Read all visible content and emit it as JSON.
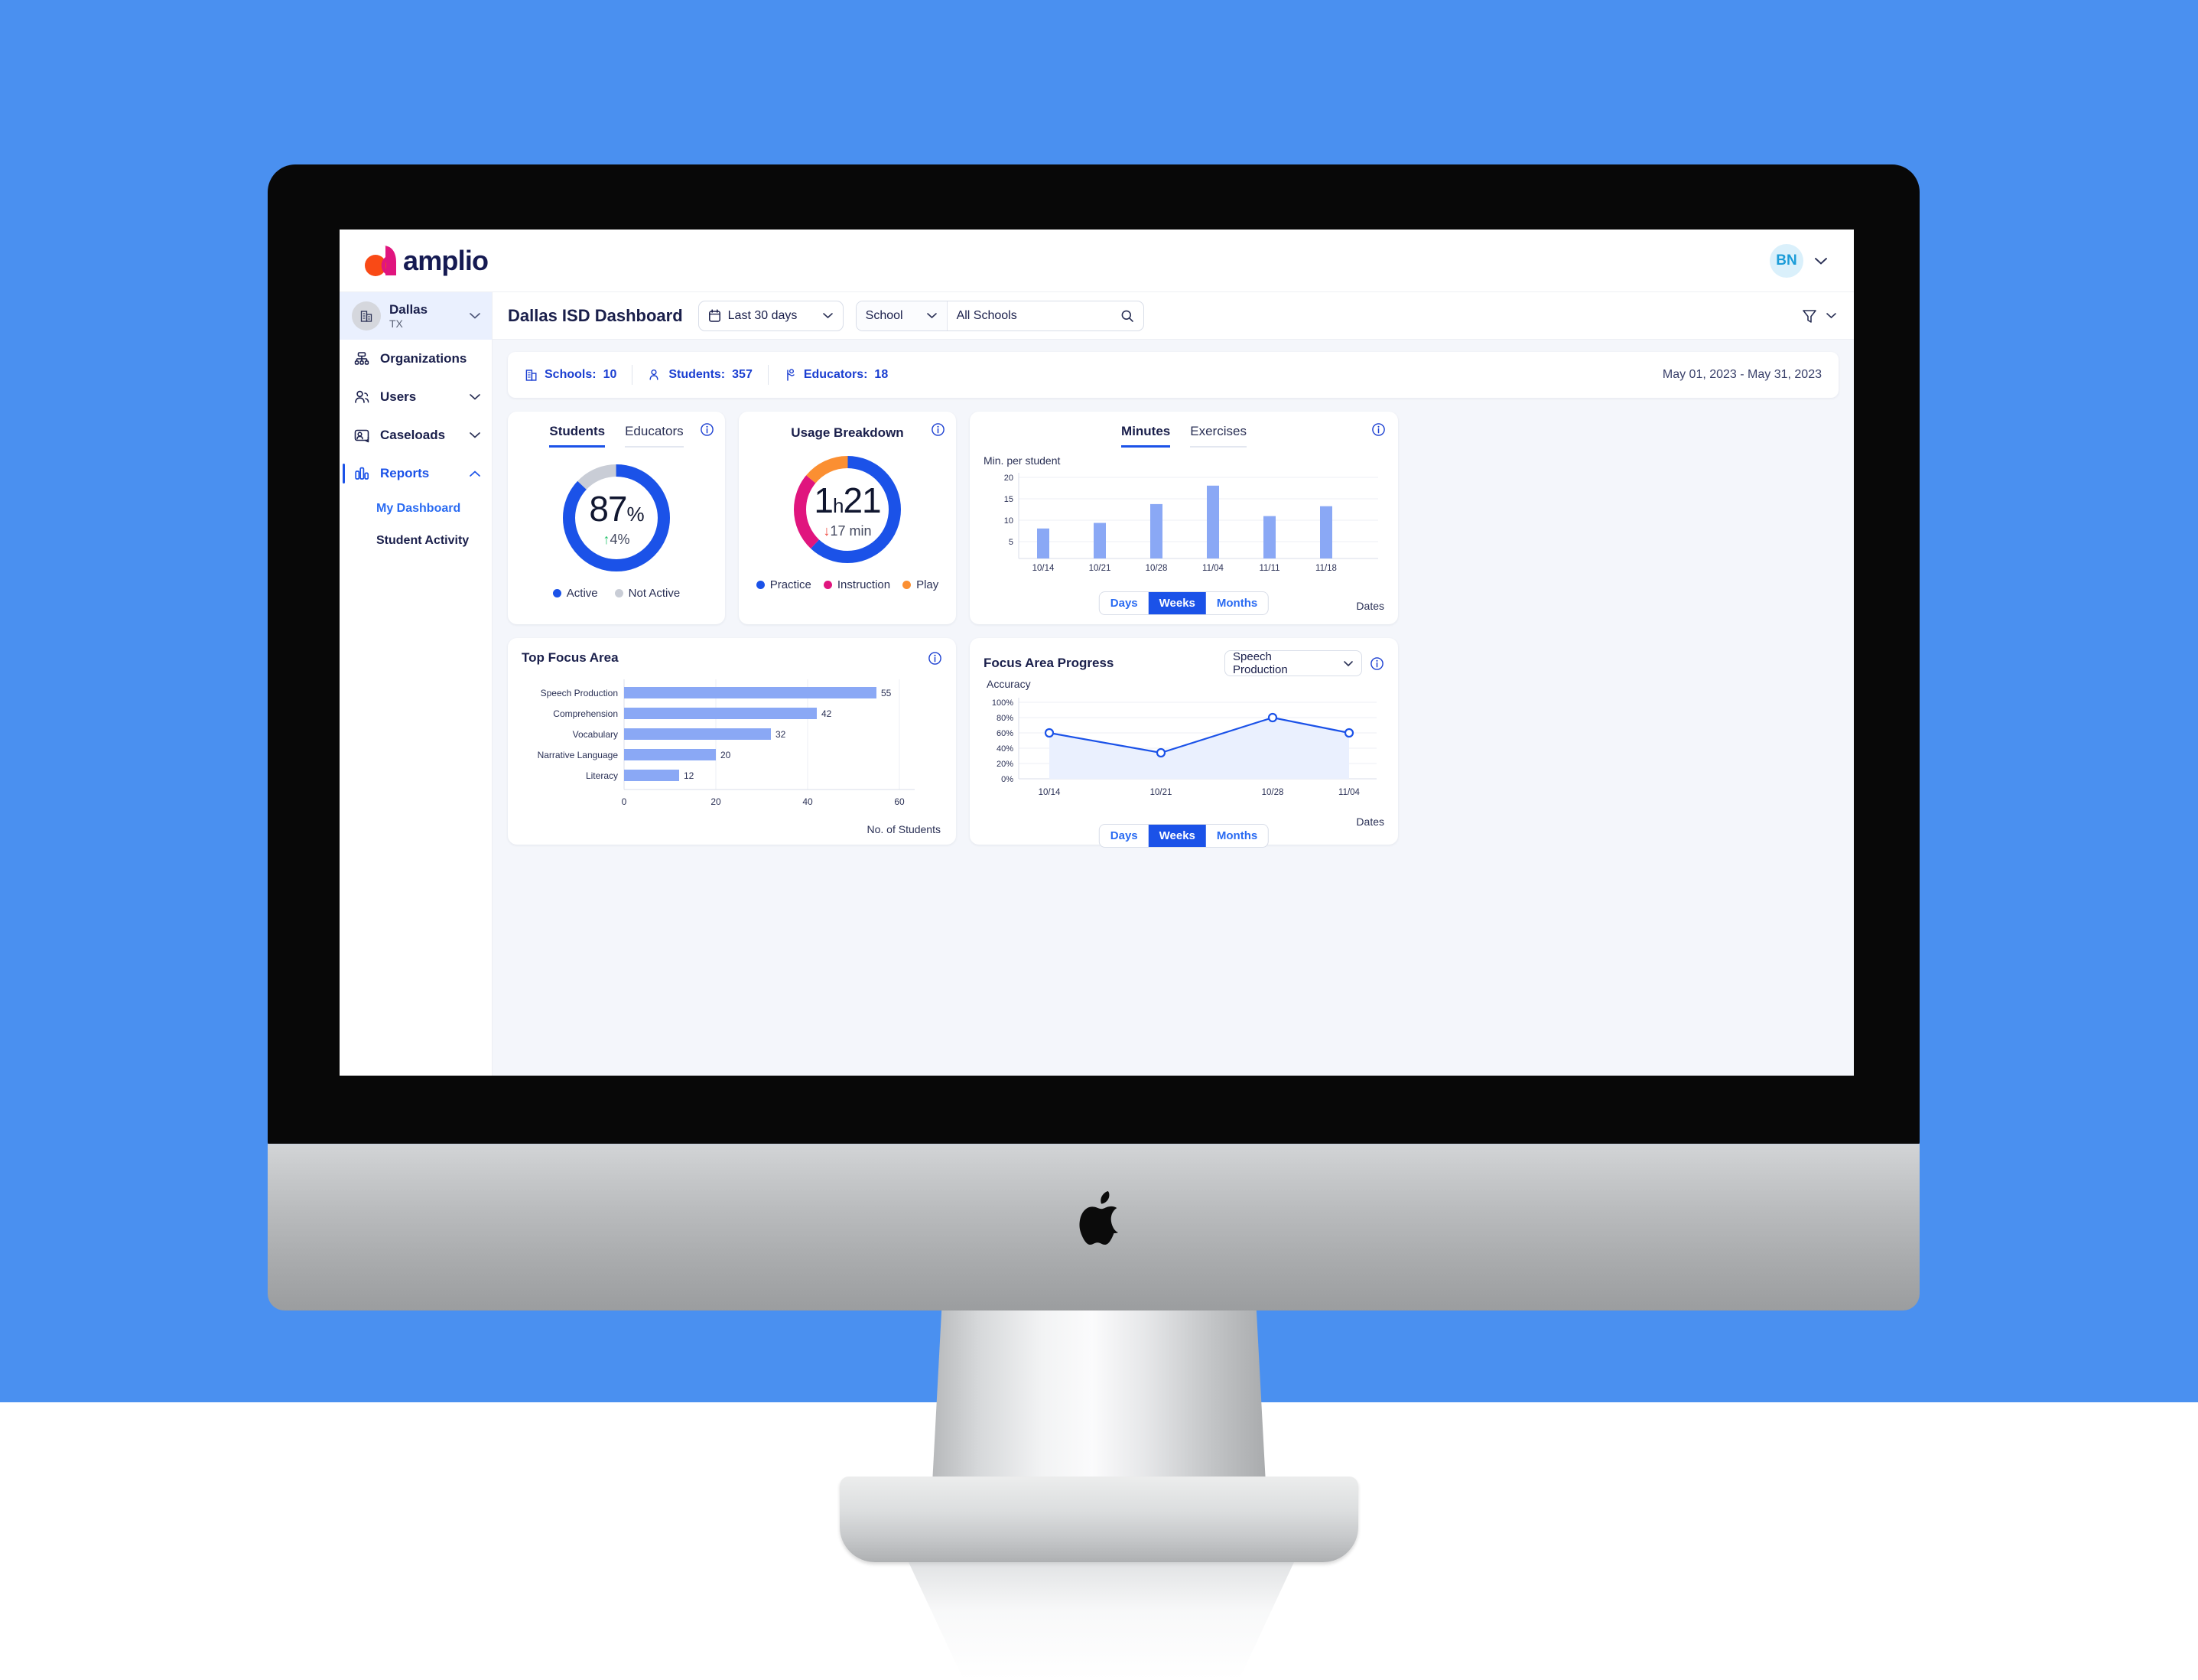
{
  "brand": {
    "name": "amplio",
    "logo_icon": "amplio-logo-icon"
  },
  "account": {
    "initials": "BN",
    "chevron_icon": "chevron-down-icon"
  },
  "sidebar": {
    "org": {
      "name": "Dallas",
      "state": "TX",
      "icon": "building-icon",
      "chevron_icon": "chevron-down-icon"
    },
    "items": [
      {
        "label": "Organizations",
        "icon": "org-tree-icon",
        "chevron": false,
        "active": false
      },
      {
        "label": "Users",
        "icon": "users-icon",
        "chevron": true,
        "active": false
      },
      {
        "label": "Caseloads",
        "icon": "caseload-icon",
        "chevron": true,
        "active": false
      },
      {
        "label": "Reports",
        "icon": "bar-chart-icon",
        "chevron": true,
        "active": true
      }
    ],
    "sub_items": [
      {
        "label": "My Dashboard",
        "selected": true
      },
      {
        "label": "Student Activity",
        "selected": false
      }
    ]
  },
  "filterbar": {
    "page_title": "Dallas ISD Dashboard",
    "date_filter": {
      "label": "Last 30 days",
      "icon": "calendar-icon",
      "chevron_icon": "chevron-down-icon"
    },
    "scope_filter": {
      "label": "School",
      "chevron_icon": "chevron-down-icon"
    },
    "search": {
      "value": "All Schools",
      "placeholder": "All Schools",
      "icon": "search-icon"
    },
    "filter_icon": "funnel-icon",
    "filter_chevron_icon": "chevron-down-icon"
  },
  "stats": {
    "schools": {
      "label": "Schools:",
      "value": "10",
      "icon": "school-building-icon"
    },
    "students": {
      "label": "Students:",
      "value": "357",
      "icon": "student-icon"
    },
    "educators": {
      "label": "Educators:",
      "value": "18",
      "icon": "educator-icon"
    },
    "date_range": "May 01, 2023 - May 31, 2023"
  },
  "cards": {
    "students": {
      "tabs": [
        {
          "label": "Students",
          "active": true
        },
        {
          "label": "Educators",
          "active": false
        }
      ],
      "info_icon": "info-icon",
      "value": "87",
      "unit": "%",
      "delta_arrow": "↑",
      "delta": "4%",
      "delta_direction": "up",
      "legend": [
        {
          "label": "Active",
          "color": "#1b52e8"
        },
        {
          "label": "Not Active",
          "color": "#c9cdd6"
        }
      ]
    },
    "usage": {
      "title": "Usage Breakdown",
      "info_icon": "info-icon",
      "value_hours": "1",
      "value_h": "h",
      "value_minutes": "21",
      "delta_arrow": "↓",
      "delta": "17 min",
      "delta_direction": "down",
      "legend": [
        {
          "label": "Practice",
          "color": "#1b52e8"
        },
        {
          "label": "Instruction",
          "color": "#e0157e"
        },
        {
          "label": "Play",
          "color": "#fb8f32"
        }
      ]
    },
    "minutes": {
      "tabs": [
        {
          "label": "Minutes",
          "active": true
        },
        {
          "label": "Exercises",
          "active": false
        }
      ],
      "info_icon": "info-icon",
      "range_toggle": [
        {
          "label": "Days",
          "active": false
        },
        {
          "label": "Weeks",
          "active": true
        },
        {
          "label": "Months",
          "active": false
        }
      ]
    },
    "top_focus": {
      "title": "Top Focus Area",
      "info_icon": "info-icon"
    },
    "focus_progress": {
      "title": "Focus Area Progress",
      "info_icon": "info-icon",
      "select_value": "Speech Production",
      "select_chevron_icon": "chevron-down-icon",
      "range_toggle": [
        {
          "label": "Days",
          "active": false
        },
        {
          "label": "Weeks",
          "active": true
        },
        {
          "label": "Months",
          "active": false
        }
      ]
    }
  },
  "chart_data": [
    {
      "type": "pie",
      "title": "Students Active",
      "labels": [
        "Active",
        "Not Active"
      ],
      "values": [
        87,
        13
      ],
      "colors": [
        "#1b52e8",
        "#c9cdd6"
      ],
      "center_label": "87%",
      "legend_position": "bottom"
    },
    {
      "type": "pie",
      "title": "Usage Breakdown",
      "labels": [
        "Practice",
        "Instruction",
        "Play"
      ],
      "values": [
        62,
        24,
        14
      ],
      "colors": [
        "#1b52e8",
        "#e0157e",
        "#fb8f32"
      ],
      "center_label": "1h21",
      "legend_position": "bottom"
    },
    {
      "type": "bar",
      "title": "Minutes",
      "ylabel": "Min. per student",
      "xlabel": "Dates",
      "categories": [
        "10/14",
        "10/21",
        "10/28",
        "11/04",
        "11/11",
        "11/18"
      ],
      "values": [
        7.0,
        8.3,
        12.7,
        17.0,
        9.9,
        12.2
      ],
      "yticks": [
        5,
        10,
        15,
        20
      ],
      "ylim": [
        0,
        22
      ],
      "bar_color": "#8aa8f5",
      "grid": true
    },
    {
      "type": "bar",
      "orientation": "horizontal",
      "title": "Top Focus Area",
      "xlabel": "No. of Students",
      "categories": [
        "Speech Production",
        "Comprehension",
        "Vocabulary",
        "Narrative Language",
        "Literacy"
      ],
      "values": [
        55,
        42,
        32,
        20,
        12
      ],
      "xticks": [
        0,
        20,
        40,
        60
      ],
      "xlim": [
        0,
        60
      ],
      "bar_color": "#8aa8f5",
      "grid": true
    },
    {
      "type": "line",
      "title": "Focus Area Progress",
      "ylabel": "Accuracy",
      "xlabel": "Dates",
      "categories": [
        "10/14",
        "10/21",
        "10/28",
        "11/04"
      ],
      "values": [
        60,
        34,
        80,
        60
      ],
      "yticks": [
        "0%",
        "20%",
        "40%",
        "60%",
        "80%",
        "100%"
      ],
      "ylim": [
        0,
        100
      ],
      "line_color": "#1b52e8",
      "fill_color": "#eaf0fe",
      "grid": true
    }
  ]
}
